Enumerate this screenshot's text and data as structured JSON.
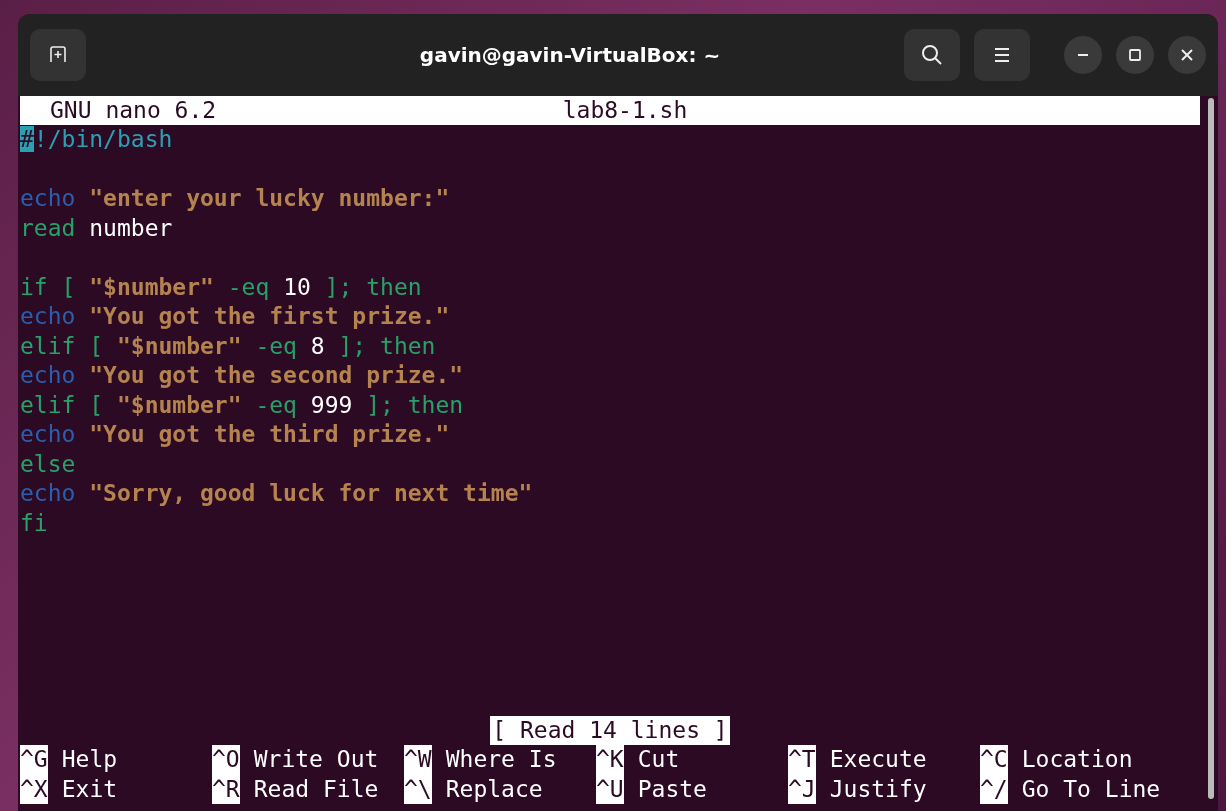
{
  "window": {
    "title": "gavin@gavin-VirtualBox: ~"
  },
  "editor": {
    "app": "GNU nano 6.2",
    "filename": "lab8-1.sh",
    "lines": [
      {
        "kind": "code",
        "tokens": [
          {
            "kind": "cursor",
            "text": "#"
          },
          {
            "kind": "shebang",
            "text": "!/bin/bash"
          }
        ]
      },
      {
        "kind": "blank"
      },
      {
        "kind": "code",
        "tokens": [
          {
            "kind": "builtin",
            "text": "echo"
          },
          {
            "kind": "string",
            "text": " \"enter your lucky number:\""
          }
        ]
      },
      {
        "kind": "code",
        "tokens": [
          {
            "kind": "keyword",
            "text": "read"
          },
          {
            "kind": "plain",
            "text": " number"
          }
        ]
      },
      {
        "kind": "blank"
      },
      {
        "kind": "code",
        "tokens": [
          {
            "kind": "keyword",
            "text": "if [ "
          },
          {
            "kind": "string",
            "text": "\"$number\""
          },
          {
            "kind": "keyword",
            "text": " -eq "
          },
          {
            "kind": "plain",
            "text": "10"
          },
          {
            "kind": "keyword",
            "text": " ]; then"
          }
        ]
      },
      {
        "kind": "code",
        "tokens": [
          {
            "kind": "builtin",
            "text": "echo"
          },
          {
            "kind": "string",
            "text": " \"You got the first prize.\""
          }
        ]
      },
      {
        "kind": "code",
        "tokens": [
          {
            "kind": "keyword",
            "text": "elif [ "
          },
          {
            "kind": "string",
            "text": "\"$number\""
          },
          {
            "kind": "keyword",
            "text": " -eq "
          },
          {
            "kind": "plain",
            "text": "8"
          },
          {
            "kind": "keyword",
            "text": " ]; then"
          }
        ]
      },
      {
        "kind": "code",
        "tokens": [
          {
            "kind": "builtin",
            "text": "echo"
          },
          {
            "kind": "string",
            "text": " \"You got the second prize.\""
          }
        ]
      },
      {
        "kind": "code",
        "tokens": [
          {
            "kind": "keyword",
            "text": "elif [ "
          },
          {
            "kind": "string",
            "text": "\"$number\""
          },
          {
            "kind": "keyword",
            "text": " -eq "
          },
          {
            "kind": "plain",
            "text": "999"
          },
          {
            "kind": "keyword",
            "text": " ]; then"
          }
        ]
      },
      {
        "kind": "code",
        "tokens": [
          {
            "kind": "builtin",
            "text": "echo"
          },
          {
            "kind": "string",
            "text": " \"You got the third prize.\""
          }
        ]
      },
      {
        "kind": "code",
        "tokens": [
          {
            "kind": "keyword",
            "text": "else"
          }
        ]
      },
      {
        "kind": "code",
        "tokens": [
          {
            "kind": "builtin",
            "text": "echo"
          },
          {
            "kind": "string",
            "text": " \"Sorry, good luck for next time\""
          }
        ]
      },
      {
        "kind": "code",
        "tokens": [
          {
            "kind": "keyword",
            "text": "fi"
          }
        ]
      }
    ]
  },
  "status": "[ Read 14 lines ]",
  "shortcuts": [
    [
      {
        "key": "^G",
        "label": "Help"
      },
      {
        "key": "^O",
        "label": "Write Out"
      },
      {
        "key": "^W",
        "label": "Where Is"
      },
      {
        "key": "^K",
        "label": "Cut"
      },
      {
        "key": "^T",
        "label": "Execute"
      },
      {
        "key": "^C",
        "label": "Location"
      }
    ],
    [
      {
        "key": "^X",
        "label": "Exit"
      },
      {
        "key": "^R",
        "label": "Read File"
      },
      {
        "key": "^\\",
        "label": "Replace"
      },
      {
        "key": "^U",
        "label": "Paste"
      },
      {
        "key": "^J",
        "label": "Justify"
      },
      {
        "key": "^/",
        "label": "Go To Line"
      }
    ]
  ]
}
